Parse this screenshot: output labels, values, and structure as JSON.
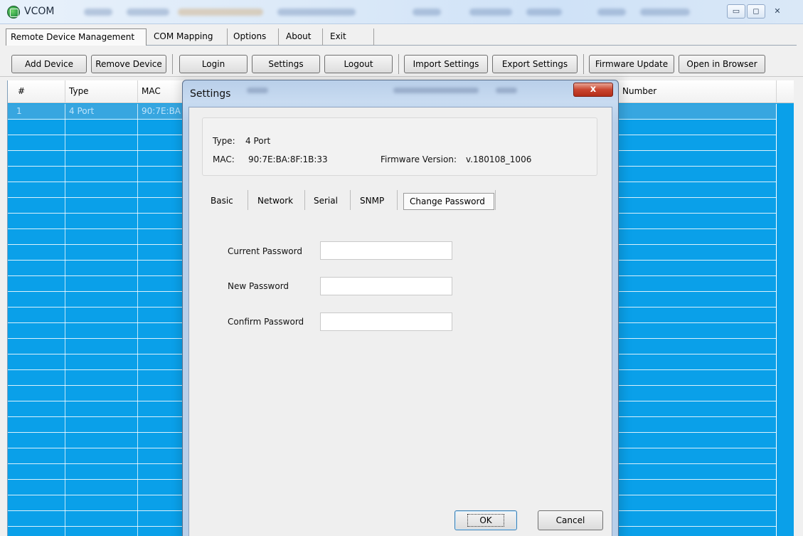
{
  "window": {
    "title": "VCOM",
    "controls": {
      "minimize": "▭",
      "maximize": "◻",
      "close": "✕"
    }
  },
  "menu_tabs": [
    {
      "label": "Remote Device Management",
      "active": true
    },
    {
      "label": "COM Mapping"
    },
    {
      "label": "Options"
    },
    {
      "label": "About"
    },
    {
      "label": "Exit"
    }
  ],
  "toolbar": {
    "add_device": "Add Device",
    "remove_device": "Remove Device",
    "login": "Login",
    "settings": "Settings",
    "logout": "Logout",
    "import_settings": "Import Settings",
    "export_settings": "Export Settings",
    "firmware_update": "Firmware Update",
    "open_in_browser": "Open in Browser"
  },
  "grid": {
    "columns": [
      "#",
      "Type",
      "MAC",
      "Number"
    ],
    "rows": [
      {
        "num": "1",
        "type": "4 Port",
        "mac": "90:7E:BA"
      }
    ],
    "colors": {
      "row_bg": "#0aa0e9",
      "selected_row": "#37a6e0"
    }
  },
  "dialog": {
    "title": "Settings",
    "close_label": "x",
    "type_label": "Type:",
    "type_value": "4 Port",
    "mac_label": "MAC:",
    "mac_value": "90:7E:BA:8F:1B:33",
    "firmware_label": "Firmware Version:",
    "firmware_value": "v.180108_1006",
    "tabs": [
      {
        "label": "Basic"
      },
      {
        "label": "Network"
      },
      {
        "label": "Serial"
      },
      {
        "label": "SNMP"
      },
      {
        "label": "Change Password",
        "active": true
      }
    ],
    "fields": {
      "current_password": {
        "label": "Current Password",
        "value": ""
      },
      "new_password": {
        "label": "New Password",
        "value": ""
      },
      "confirm_password": {
        "label": "Confirm Password",
        "value": ""
      }
    },
    "ok_label": "OK",
    "cancel_label": "Cancel"
  }
}
